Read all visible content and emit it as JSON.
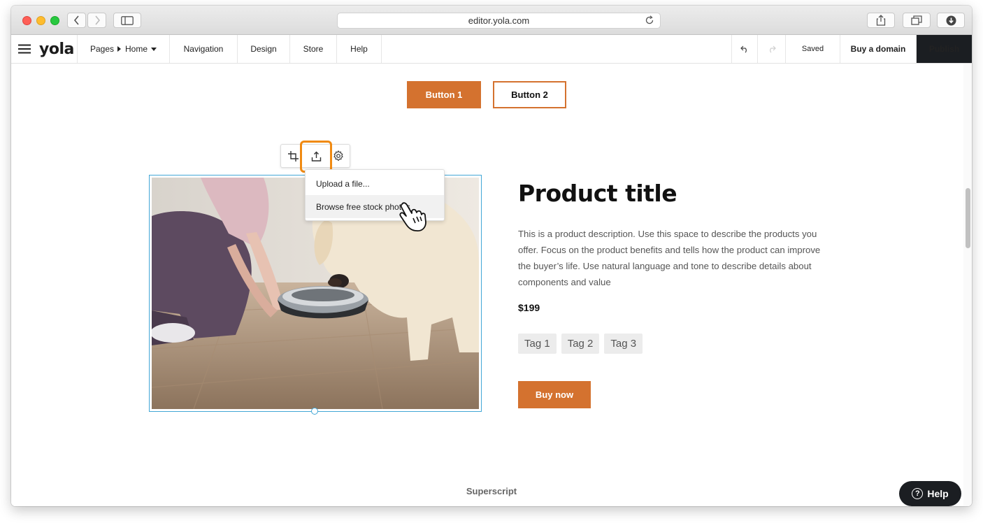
{
  "browser": {
    "url": "editor.yola.com"
  },
  "appbar": {
    "logo": "yola",
    "pages_label": "Pages",
    "page_name": "Home",
    "nav": [
      "Navigation",
      "Design",
      "Store",
      "Help"
    ],
    "saved_label": "Saved",
    "buy_domain_label": "Buy a domain",
    "publish_label": "Publish"
  },
  "canvas": {
    "button1_label": "Button 1",
    "button2_label": "Button 2",
    "image_menu": {
      "upload_label": "Upload a file...",
      "stock_label": "Browse free stock photos"
    },
    "product": {
      "title": "Product title",
      "description": "This is a product description. Use this space to describe the products you offer. Focus on the product benefits and tells how the product can improve the buyer’s life. Use natural language and tone to describe details about components and value",
      "price": "$199",
      "tags": [
        "Tag 1",
        "Tag 2",
        "Tag 3"
      ],
      "buy_label": "Buy now"
    },
    "superscript": "Superscript"
  },
  "help_button": {
    "label": "Help"
  },
  "colors": {
    "accent": "#d4722f",
    "highlight": "#f08a12",
    "selection": "#42a7d6",
    "domain_link": "#d0134d",
    "publish_bg": "#1b1e22"
  }
}
